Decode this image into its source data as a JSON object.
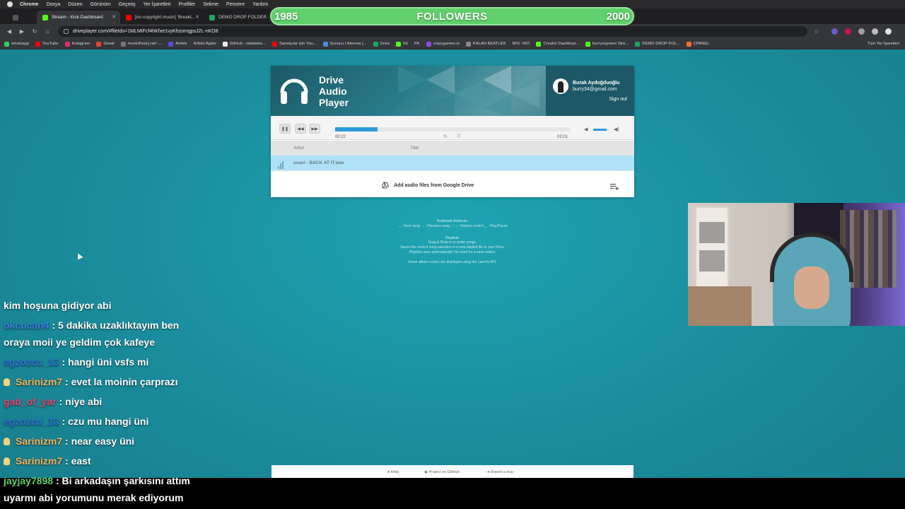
{
  "menubar": {
    "items": [
      "Chrome",
      "Dosya",
      "Düzen",
      "Görünüm",
      "Geçmiş",
      "Yer İşaretleri",
      "Profiller",
      "Sekme",
      "Pencere",
      "Yardım"
    ]
  },
  "tabs": [
    {
      "label": "",
      "color": "#555555"
    },
    {
      "label": "Stream - Kick Dashboard",
      "color": "#53fc18",
      "active": true
    },
    {
      "label": "[no copyright music] 'Breakt...",
      "color": "#ff0000"
    },
    {
      "label": "DEMO DROP FOLDER - Go...",
      "color": "#1fa463"
    }
  ],
  "address": {
    "url": "driveplayer.com/#fileIds=1MLMIFcf4hKfxe1vyKhzomgpsJ2L-nKO8"
  },
  "bookmarks": {
    "items": [
      "whatsapp",
      "YouTube",
      "Instagram",
      "Gmail",
      "musictheory.net -...",
      "Artists",
      "Artists Apple",
      "GitHub - sebdelso...",
      "Sanatçılar için You...",
      "Sunucu | Aternos |...",
      "Drive",
      "Kit",
      "PK",
      "crazygames.io",
      "KALAN BEATLER",
      "MXL V87i",
      "Creator Dashboar...",
      "burrysoprano Stre...",
      "DEMO DROP FOL...",
      "CPANEL"
    ],
    "all_label": "Tüm Yer İşaretleri"
  },
  "followers": {
    "current": "1985",
    "label": "FOLLOWERS",
    "goal": "2000",
    "color": "#5fd06b"
  },
  "player": {
    "logo_line1": "Drive",
    "logo_line2": "Audio",
    "logo_line3": "Player",
    "user_name": "Burak Aydoğduoğlu",
    "user_email": "burry34@gmail.com",
    "sign_out": "Sign out",
    "time_current": "00:22",
    "time_total": "02:01",
    "progress_fraction": 0.18,
    "volume_fraction": 0.85,
    "col_artist": "Artist",
    "col_title": "Title",
    "track": "suavi - BACK AT IT.wav",
    "add_files": "Add audio files from Google Drive",
    "accent": "#2b9bdc"
  },
  "help": {
    "shortcuts_title": "Keyboard shortcuts:",
    "shortcuts_text": "→ : Next song  ← : Previous song  ↑ / ↓ : Volume control  ␣ : Play/Pause",
    "playlists_title": "Playlists:",
    "playlists_line1": "Drag & Drop to re-order songs.",
    "playlists_line2": "Saves the current song selection in a new playlist file in your Drive.",
    "playlists_line3": "Playlists save automatically! No need for a save button.",
    "covers_text": "Some album covers are displayed using the Last.fm API."
  },
  "chat": [
    {
      "user": "",
      "msg": "kim hoşuna gidiyor abi",
      "color": "#ffffff"
    },
    {
      "user": "okcucan4",
      "msg": " : 5 dakika uzaklıktayım ben",
      "color": "#3b7be0"
    },
    {
      "user": "",
      "msg": "oraya moii ye geldim çok kafeye",
      "color": "#ffffff"
    },
    {
      "user": "egzozcu_13",
      "msg": " : hangi üni vsfs mi",
      "color": "#2f6fd6"
    },
    {
      "user": "Sarinizm7",
      "msg": " : evet la moinin çarprazı",
      "color": "#f2b35c",
      "badge": true
    },
    {
      "user": "gad_of_yar",
      "msg": " : niye abi",
      "color": "#e0456b"
    },
    {
      "user": "egzozcu_13",
      "msg": " : czu mu hangi üni",
      "color": "#2f6fd6"
    },
    {
      "user": "Sarinizm7",
      "msg": " : near easy üni",
      "color": "#f2b35c",
      "badge": true
    },
    {
      "user": "Sarinizm7",
      "msg": " : east",
      "color": "#f2b35c",
      "badge": true
    },
    {
      "user": "jayjay7898",
      "msg": " : Bi arkadaşın şarkısını attım",
      "color": "#5fd06b"
    },
    {
      "user": "",
      "msg": "uyarmı abi yorumunu merak ediyorum",
      "color": "#ffffff"
    }
  ],
  "footer": {
    "help": "Help",
    "github": "Project on GitHub",
    "bug": "Report a bug"
  }
}
